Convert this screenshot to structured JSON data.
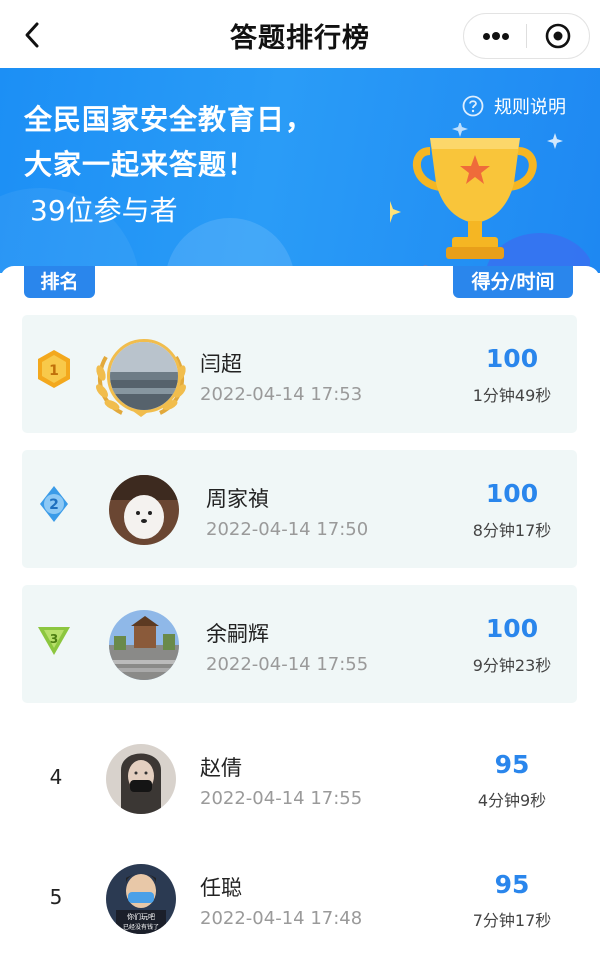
{
  "nav": {
    "title": "答题排行榜"
  },
  "banner": {
    "headline_line1": "全民国家安全教育日，",
    "headline_line2": "大家一起来答题！",
    "participants": "39位参与者",
    "rules_label": "规则说明"
  },
  "table": {
    "col_rank": "排名",
    "col_score": "得分/时间"
  },
  "rows": [
    {
      "rank": "1",
      "medal": "gold",
      "name": "闫超",
      "time": "2022-04-14 17:53",
      "score": "100",
      "duration": "1分钟49秒"
    },
    {
      "rank": "2",
      "medal": "blue",
      "name": "周家禎",
      "time": "2022-04-14 17:50",
      "score": "100",
      "duration": "8分钟17秒"
    },
    {
      "rank": "3",
      "medal": "green",
      "name": "余嗣辉",
      "time": "2022-04-14 17:55",
      "score": "100",
      "duration": "9分钟23秒"
    },
    {
      "rank": "4",
      "medal": "",
      "name": "赵倩",
      "time": "2022-04-14 17:55",
      "score": "95",
      "duration": "4分钟9秒"
    },
    {
      "rank": "5",
      "medal": "",
      "name": "任聪",
      "time": "2022-04-14 17:48",
      "score": "95",
      "duration": "7分钟17秒"
    }
  ],
  "avatar_text_row5": "你们玩吧 已经没有钱了",
  "colors": {
    "accent": "#2a86ec",
    "banner": "#1c8ff5",
    "top_row_bg": "#f0f7f7"
  }
}
